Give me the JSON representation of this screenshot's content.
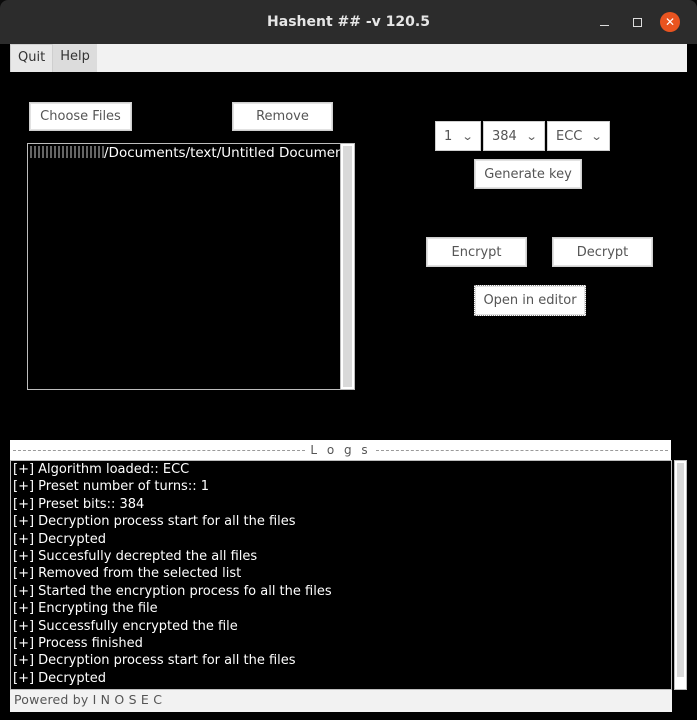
{
  "window": {
    "title": "Hashent ## -v 120.5",
    "controls": {
      "minimize": "–",
      "close": "✕"
    }
  },
  "menu": {
    "items": [
      {
        "label": "Quit"
      },
      {
        "label": "Help"
      }
    ]
  },
  "files": {
    "choose_label": "Choose Files",
    "remove_label": "Remove",
    "entries": [
      {
        "path_visible": "/Documents/text/Untitled Document"
      }
    ]
  },
  "settings": {
    "turns": "1",
    "bits": "384",
    "algorithm": "ECC",
    "generate_key_label": "Generate key"
  },
  "actions": {
    "encrypt_label": "Encrypt",
    "decrypt_label": "Decrypt",
    "open_editor_label": "Open in editor"
  },
  "logs": {
    "header": "Logs",
    "lines": [
      "[+] Algorithm loaded:: ECC",
      "[+] Preset number of turns:: 1",
      "[+] Preset bits:: 384",
      "[+] Decryption process start for all the files",
      "[+] Decrypted",
      "[+] Succesfully decrepted the all files",
      "[+] Removed from the selected list",
      "[+] Started the encryption process fo all the files",
      "[+] Encrypting the file",
      "[+] Successfully encrypted the file",
      "[+] Process finished",
      "[+] Decryption process start for all the files",
      "[+] Decrypted"
    ]
  },
  "status": {
    "text": "Powered by I N O S E C"
  },
  "colors": {
    "close_button": "#e95420",
    "titlebar": "#2c2c2c",
    "background": "#000000"
  }
}
